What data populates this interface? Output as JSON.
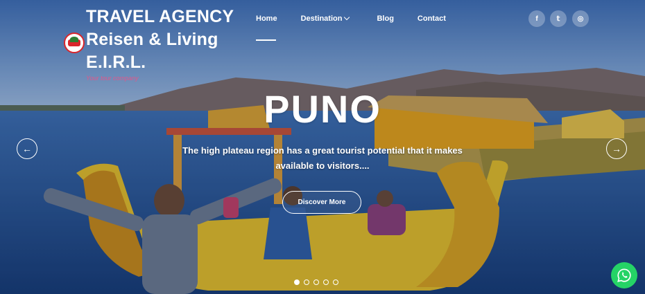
{
  "brand": {
    "line1": "TRAVEL AGENCY",
    "line2": "Reisen & Living",
    "line3": "E.I.R.L.",
    "tagline": "Your tour company"
  },
  "nav": {
    "items": [
      {
        "label": "Home",
        "active": true
      },
      {
        "label": "Destination",
        "has_dropdown": true
      },
      {
        "label": "Blog"
      },
      {
        "label": "Contact"
      }
    ]
  },
  "social": [
    {
      "name": "facebook-icon",
      "glyph": "f"
    },
    {
      "name": "twitter-icon",
      "glyph": "𝕥"
    },
    {
      "name": "instagram-icon",
      "glyph": "◎"
    }
  ],
  "slide": {
    "title": "PUNO",
    "description": "The high plateau region has a great tourist potential that it makes available to visitors....",
    "button_label": "Discover More",
    "prev_glyph": "←",
    "next_glyph": "→"
  },
  "slider": {
    "dots": 5,
    "active_index": 0
  },
  "colors": {
    "accent": "#ffffff",
    "tagline": "#e2568a",
    "whatsapp": "#25d366"
  }
}
